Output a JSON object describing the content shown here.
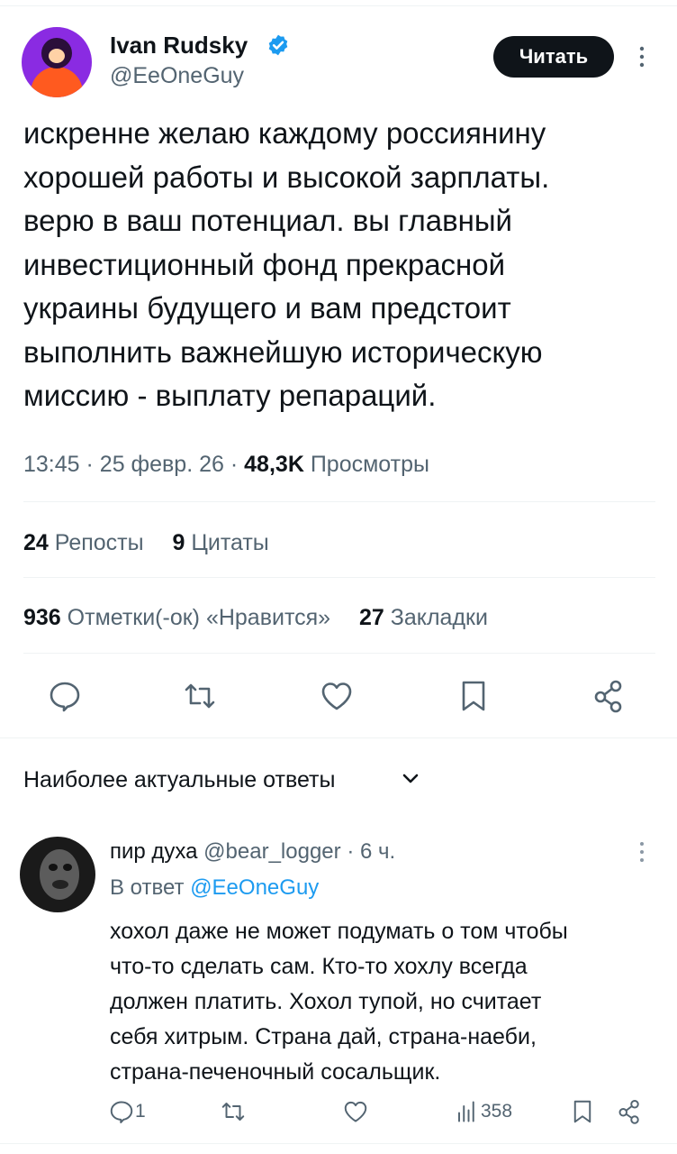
{
  "tweet": {
    "author_name": "Ivan Rudsky",
    "author_handle": "@EeOneGuy",
    "follow_label": "Читать",
    "text_lines": [
      "искренне желаю каждому россиянину",
      "хорошей работы и высокой зарплаты.",
      "верю в ваш потенциал. вы главный",
      "инвестиционный фонд прекрасной",
      "украины будущего и вам предстоит",
      "выполнить важнейшую историческую",
      "миссию - выплату репараций."
    ],
    "meta": {
      "time": "13:45",
      "date": "25 февр. 26",
      "views_count": "48,3K",
      "views_label": "Просмотры"
    },
    "stats": {
      "reposts_count": "24",
      "reposts_label": "Репосты",
      "quotes_count": "9",
      "quotes_label": "Цитаты",
      "likes_count": "936",
      "likes_label": "Отметки(-ок) «Нравится»",
      "bookmarks_count": "27",
      "bookmarks_label": "Закладки"
    },
    "actions": [
      "reply-icon",
      "retweet-icon",
      "heart-icon",
      "bookmark-icon",
      "share-icon"
    ]
  },
  "replies_section": {
    "title": "Наиболее актуальные ответы"
  },
  "reply": {
    "author_name": "пир духа",
    "author_handle": "@bear_logger",
    "time_ago": "6 ч.",
    "reply_to_label": "В ответ",
    "reply_to_handle": "@EeOneGuy",
    "text_lines": [
      "хохол даже не может подумать о том чтобы",
      "что-то сделать сам. Кто-то хохлу всегда",
      "должен платить. Хохол тупой, но считает",
      "себя хитрым. Страна дай, страна-наеби,",
      "страна-печеночный сосальщик."
    ],
    "reply_count": "1",
    "views_count": "358"
  },
  "colors": {
    "text": "#0f1419",
    "secondary": "#536471",
    "accent": "#1d9bf0",
    "divider": "#eff3f4"
  }
}
